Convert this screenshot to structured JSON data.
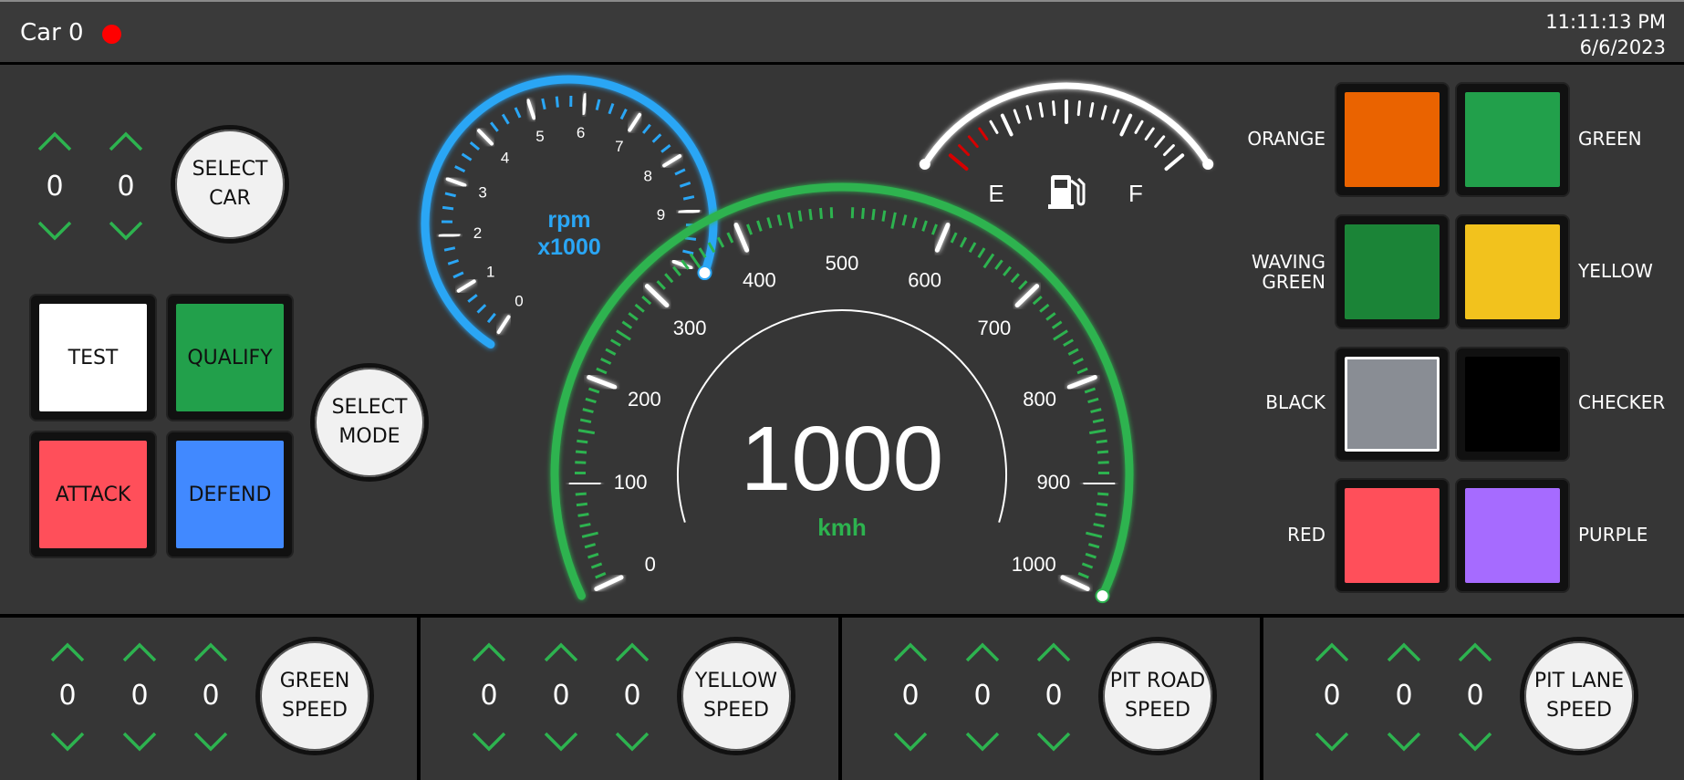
{
  "header": {
    "car_title": "Car 0",
    "status_color": "#ff0000",
    "time": "11:11:13 PM",
    "date": "6/6/2023"
  },
  "car_select": {
    "digits": [
      "0",
      "0"
    ],
    "button_line1": "SELECT",
    "button_line2": "CAR"
  },
  "modes": {
    "tiles": [
      {
        "label": "TEST",
        "color": "#ffffff"
      },
      {
        "label": "QUALIFY",
        "color": "#22a04b"
      },
      {
        "label": "ATTACK",
        "color": "#ff4f5a"
      },
      {
        "label": "DEFEND",
        "color": "#4189ff"
      }
    ],
    "button_line1": "SELECT",
    "button_line2": "MODE"
  },
  "rpm_gauge": {
    "label_line1": "rpm",
    "label_line2": "x1000",
    "ticks": [
      "0",
      "1",
      "2",
      "3",
      "4",
      "5",
      "6",
      "7",
      "8",
      "9"
    ],
    "value": 10,
    "max": 10,
    "color": "#2aa6f5"
  },
  "speed_gauge": {
    "value": "1000",
    "unit": "kmh",
    "ticks": [
      "0",
      "100",
      "200",
      "300",
      "400",
      "500",
      "600",
      "700",
      "800",
      "900",
      "1000"
    ],
    "max": 1000,
    "color": "#2db34f"
  },
  "fuel_gauge": {
    "empty_label": "E",
    "full_label": "F",
    "icon": "fuel-pump-icon",
    "level": 1.0,
    "low_color": "#d60000"
  },
  "flags": {
    "left": [
      {
        "label": "ORANGE",
        "color": "#ea6300"
      },
      {
        "label": "WAVING GREEN",
        "label_line1": "WAVING",
        "label_line2": "GREEN",
        "color": "#1b8437"
      },
      {
        "label": "BLACK",
        "color": "#898d94"
      },
      {
        "label": "RED",
        "color": "#ff4f5a"
      }
    ],
    "right": [
      {
        "label": "GREEN",
        "color": "#22a04b"
      },
      {
        "label": "YELLOW",
        "color": "#f2c21d"
      },
      {
        "label": "CHECKER",
        "color": "#000000"
      },
      {
        "label": "PURPLE",
        "color": "#a66bff"
      }
    ]
  },
  "speed_panels": [
    {
      "digits": [
        "0",
        "0",
        "0"
      ],
      "button_line1": "GREEN",
      "button_line2": "SPEED"
    },
    {
      "digits": [
        "0",
        "0",
        "0"
      ],
      "button_line1": "YELLOW",
      "button_line2": "SPEED"
    },
    {
      "digits": [
        "0",
        "0",
        "0"
      ],
      "button_line1": "PIT ROAD",
      "button_line2": "SPEED"
    },
    {
      "digits": [
        "0",
        "0",
        "0"
      ],
      "button_line1": "PIT LANE",
      "button_line2": "SPEED"
    }
  ]
}
